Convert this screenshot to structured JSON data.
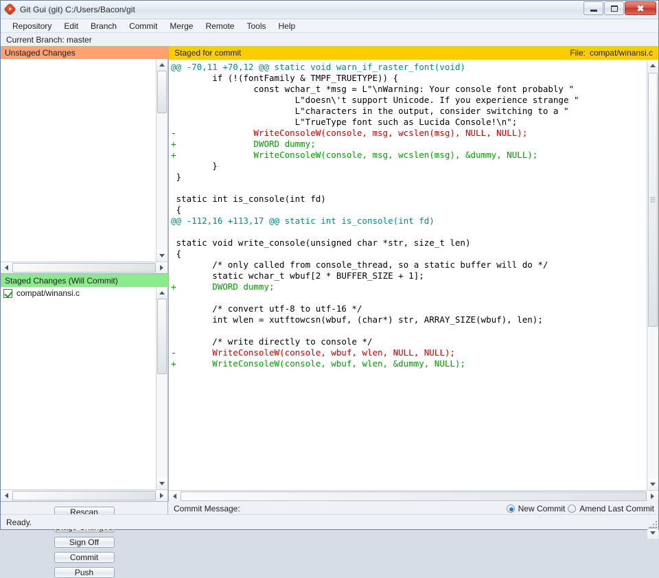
{
  "window": {
    "title": "Git Gui (git) C:/Users/Bacon/git",
    "icon": "git-gui-icon",
    "minimize_label": "–",
    "maximize_label": "□",
    "close_label": "✕"
  },
  "menu": {
    "items": [
      {
        "label": "Repository"
      },
      {
        "label": "Edit"
      },
      {
        "label": "Branch"
      },
      {
        "label": "Commit"
      },
      {
        "label": "Merge"
      },
      {
        "label": "Remote"
      },
      {
        "label": "Tools"
      },
      {
        "label": "Help"
      }
    ]
  },
  "branch_bar": {
    "label": "Current Branch:  master"
  },
  "unstaged": {
    "header": "Unstaged Changes",
    "files": []
  },
  "staged": {
    "header": "Staged Changes (Will Commit)",
    "files": [
      {
        "name": "compat/winansi.c",
        "checked": true
      }
    ]
  },
  "diff_header": {
    "status": "Staged for commit",
    "file_label": "File:",
    "file_name": "compat/winansi.c"
  },
  "diff": {
    "lines": [
      {
        "type": "hunk",
        "text": "@@ -70,11 +70,12 @@ static void warn_if_raster_font(void)"
      },
      {
        "type": "context",
        "text": "        if (!(fontFamily & TMPF_TRUETYPE)) {"
      },
      {
        "type": "context",
        "text": "                const wchar_t *msg = L\"\\nWarning: Your console font probably \""
      },
      {
        "type": "context",
        "text": "                        L\"doesn\\'t support Unicode. If you experience strange \""
      },
      {
        "type": "context",
        "text": "                        L\"characters in the output, consider switching to a \""
      },
      {
        "type": "context",
        "text": "                        L\"TrueType font such as Lucida Console!\\n\";"
      },
      {
        "type": "del",
        "text": "-               WriteConsoleW(console, msg, wcslen(msg), NULL, NULL);"
      },
      {
        "type": "add",
        "text": "+               DWORD dummy;"
      },
      {
        "type": "add",
        "text": "+               WriteConsoleW(console, msg, wcslen(msg), &dummy, NULL);"
      },
      {
        "type": "context",
        "text": "        }"
      },
      {
        "type": "context",
        "text": " }"
      },
      {
        "type": "context",
        "text": ""
      },
      {
        "type": "context",
        "text": " static int is_console(int fd)"
      },
      {
        "type": "context",
        "text": " {"
      },
      {
        "type": "hunk",
        "text": "@@ -112,16 +113,17 @@ static int is_console(int fd)"
      },
      {
        "type": "context",
        "text": ""
      },
      {
        "type": "context",
        "text": " static void write_console(unsigned char *str, size_t len)"
      },
      {
        "type": "context",
        "text": " {"
      },
      {
        "type": "context",
        "text": "        /* only called from console_thread, so a static buffer will do */"
      },
      {
        "type": "context",
        "text": "        static wchar_t wbuf[2 * BUFFER_SIZE + 1];"
      },
      {
        "type": "add",
        "text": "+       DWORD dummy;"
      },
      {
        "type": "context",
        "text": ""
      },
      {
        "type": "context",
        "text": "        /* convert utf-8 to utf-16 */"
      },
      {
        "type": "context",
        "text": "        int wlen = xutftowcsn(wbuf, (char*) str, ARRAY_SIZE(wbuf), len);"
      },
      {
        "type": "context",
        "text": ""
      },
      {
        "type": "context",
        "text": "        /* write directly to console */"
      },
      {
        "type": "del",
        "text": "-       WriteConsoleW(console, wbuf, wlen, NULL, NULL);"
      },
      {
        "type": "add",
        "text": "+       WriteConsoleW(console, wbuf, wlen, &dummy, NULL);"
      }
    ]
  },
  "buttons": [
    {
      "label": "Rescan",
      "name": "rescan-button",
      "focused": false
    },
    {
      "label": "Stage Changed",
      "name": "stage-changed-button",
      "focused": true
    },
    {
      "label": "Sign Off",
      "name": "sign-off-button",
      "focused": false
    },
    {
      "label": "Commit",
      "name": "commit-button",
      "focused": false
    },
    {
      "label": "Push",
      "name": "push-button",
      "focused": false
    }
  ],
  "commit": {
    "message_label": "Commit Message:",
    "message_value": "",
    "new_commit_label": "New Commit",
    "amend_label": "Amend Last Commit",
    "selected": "new_commit"
  },
  "status_bar": {
    "text": "Ready."
  },
  "colors": {
    "unstaged_header": "#ffa173",
    "staged_header": "#8aeb8a",
    "diff_header": "#ffcc00",
    "added_line": "#00a000",
    "deleted_line": "#d00000",
    "hunk_line": "#008b8b",
    "radio_selected": "#2a7fd4"
  }
}
